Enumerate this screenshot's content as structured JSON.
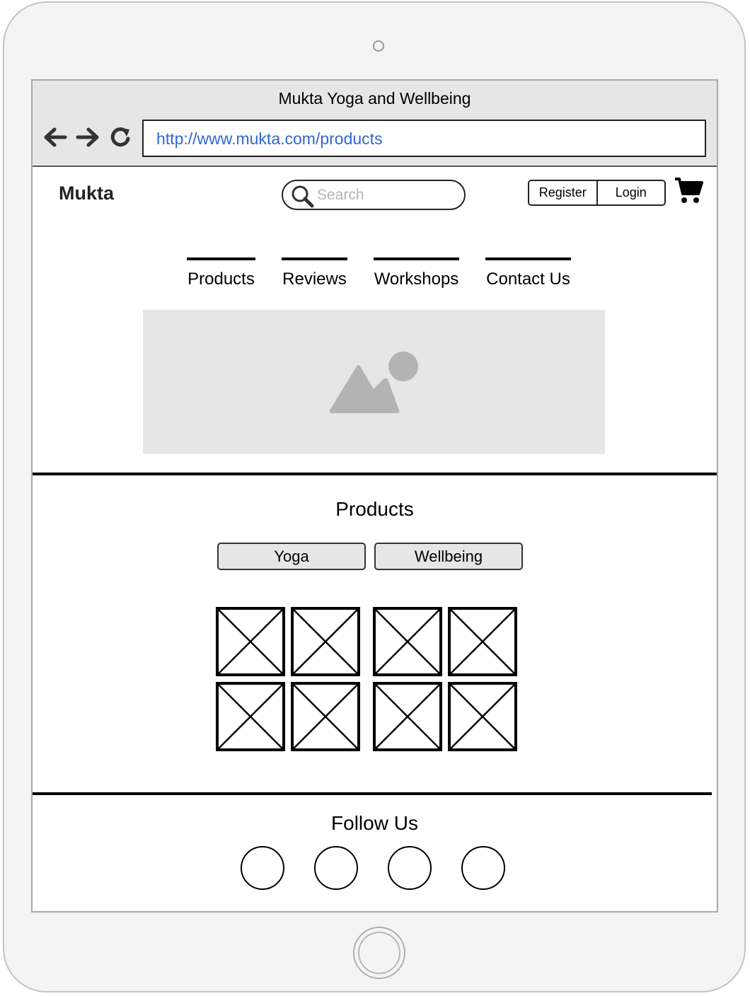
{
  "window": {
    "title": "Mukta Yoga and Wellbeing"
  },
  "address_bar": {
    "url": "http://www.mukta.com/products"
  },
  "header": {
    "logo": "Mukta",
    "search_placeholder": "Search",
    "register_label": "Register",
    "login_label": "Login"
  },
  "nav": {
    "items": [
      {
        "label": "Products"
      },
      {
        "label": "Reviews"
      },
      {
        "label": "Workshops"
      },
      {
        "label": "Contact Us"
      }
    ]
  },
  "products": {
    "title": "Products",
    "filters": [
      {
        "label": "Yoga"
      },
      {
        "label": "Wellbeing"
      }
    ],
    "item_count": 8
  },
  "footer": {
    "title": "Follow Us",
    "social_count": 4
  },
  "colors": {
    "url_text": "#2e67d6",
    "browser_bar": "#e6e6e6",
    "placeholder_fill": "#e6e6e6"
  }
}
